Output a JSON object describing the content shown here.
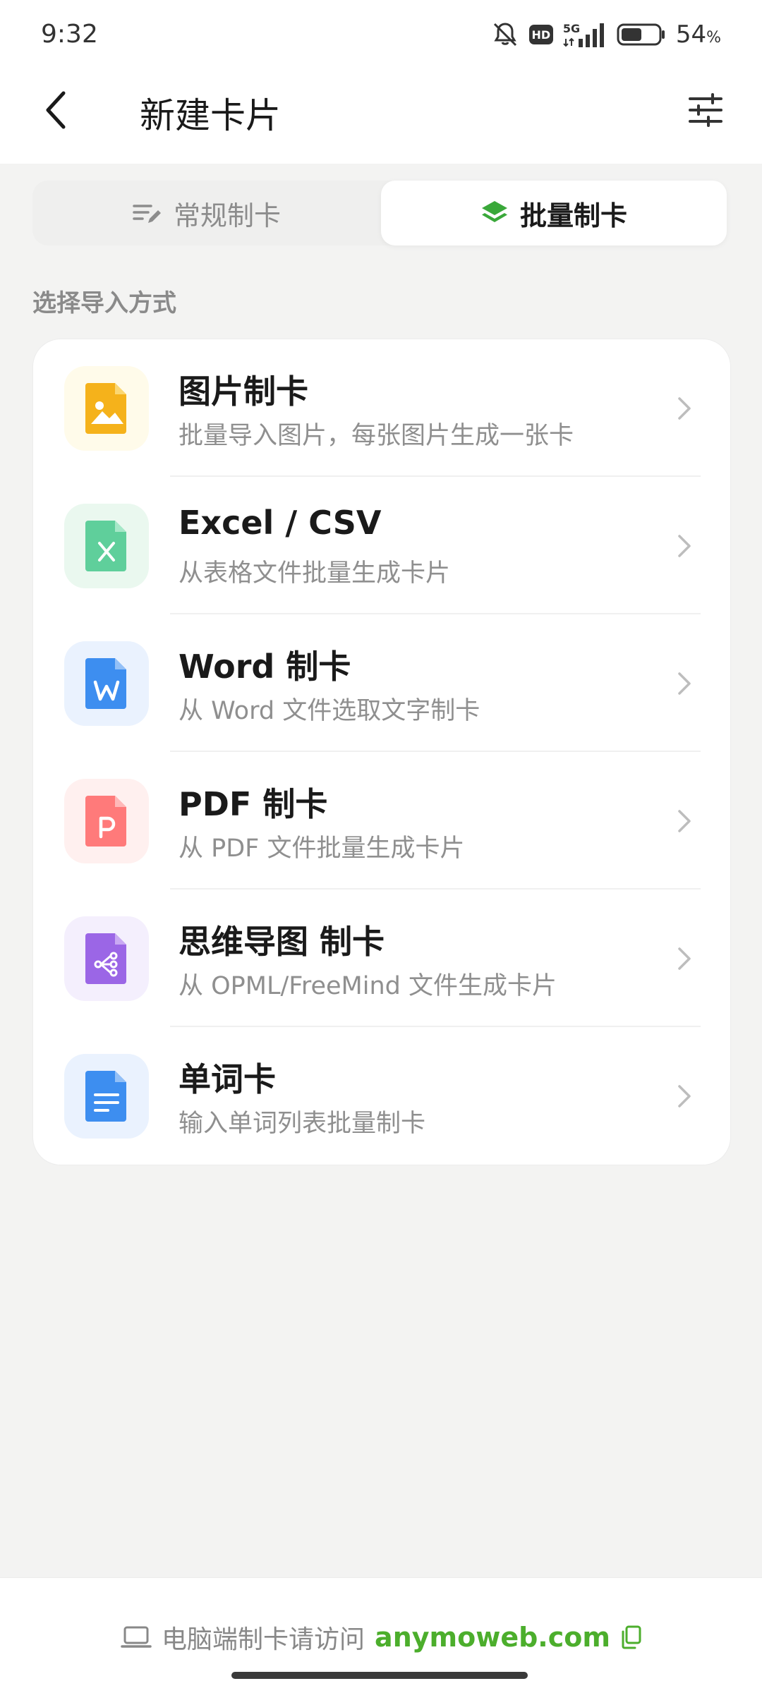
{
  "status_bar": {
    "time": "9:32",
    "network": "5G",
    "hd": "HD",
    "battery_percent": "54",
    "battery_unit": "%"
  },
  "header": {
    "title": "新建卡片"
  },
  "tabs": [
    {
      "label": "常规制卡",
      "icon": "edit-list-icon",
      "selected": false
    },
    {
      "label": "批量制卡",
      "icon": "layers-icon",
      "selected": true
    }
  ],
  "section_label": "选择导入方式",
  "import_options": [
    {
      "title": "图片制卡",
      "subtitle": "批量导入图片，每张图片生成一张卡",
      "icon": "image-file-icon",
      "color": "#f5b21b"
    },
    {
      "title": "Excel / CSV",
      "subtitle": "从表格文件批量生成卡片",
      "icon": "excel-file-icon",
      "color": "#5fcf9b"
    },
    {
      "title": "Word 制卡",
      "subtitle": "从 Word 文件选取文字制卡",
      "icon": "word-file-icon",
      "color": "#3d8ef0"
    },
    {
      "title": "PDF 制卡",
      "subtitle": "从 PDF 文件批量生成卡片",
      "icon": "pdf-file-icon",
      "color": "#ff7a7a"
    },
    {
      "title": "思维导图 制卡",
      "subtitle": "从 OPML/FreeMind 文件生成卡片",
      "icon": "mindmap-file-icon",
      "color": "#9b66e6"
    },
    {
      "title": "单词卡",
      "subtitle": "输入单词列表批量制卡",
      "icon": "document-file-icon",
      "color": "#3d8ef0"
    }
  ],
  "footer": {
    "text": "电脑端制卡请访问",
    "link": "anymoweb.com"
  },
  "colors": {
    "accent_green": "#4cae2c",
    "background": "#f3f3f2"
  }
}
